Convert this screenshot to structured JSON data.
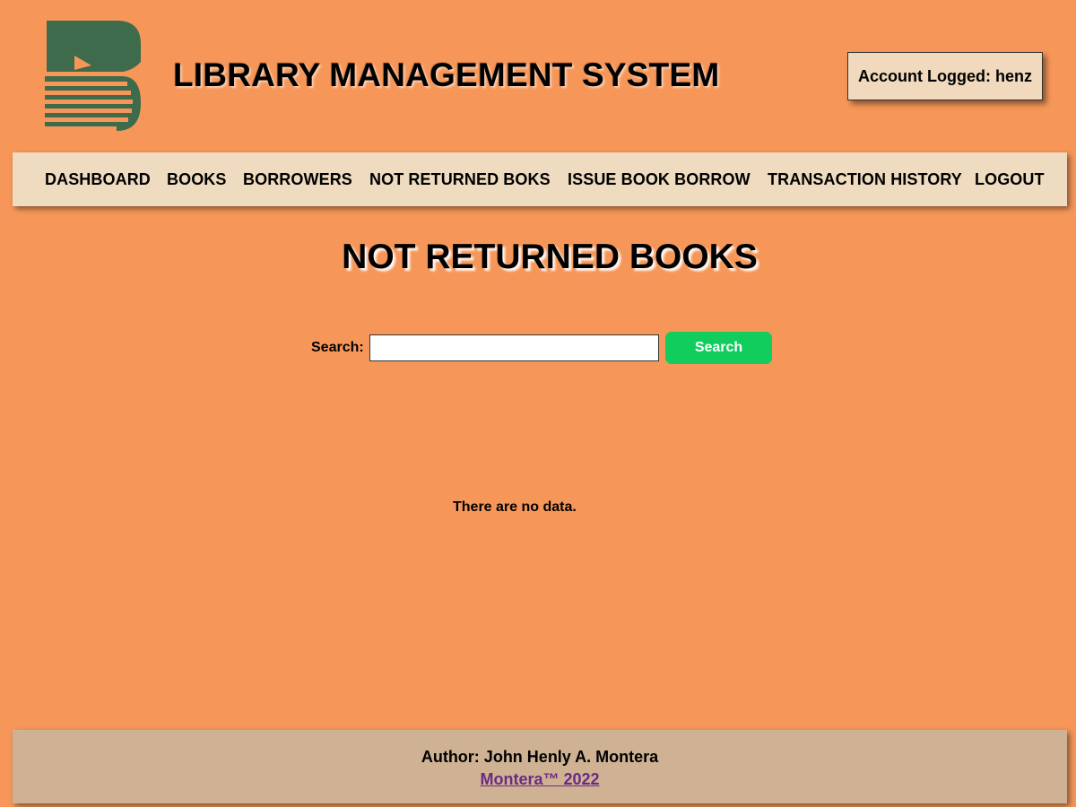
{
  "header": {
    "title": "LIBRARY MANAGEMENT SYSTEM",
    "account_text": "Account Logged: henz",
    "logo_icon": "book-logo-icon"
  },
  "nav": {
    "items": [
      {
        "label": "DASHBOARD"
      },
      {
        "label": "BOOKS"
      },
      {
        "label": "BORROWERS"
      },
      {
        "label": "NOT RETURNED BOKS"
      },
      {
        "label": "ISSUE BOOK BORROW"
      },
      {
        "label": "TRANSACTION HISTORY"
      },
      {
        "label": "LOGOUT"
      }
    ]
  },
  "main": {
    "heading": "NOT RETURNED BOOKS",
    "search_label": "Search:",
    "search_value": "",
    "search_button": "Search",
    "empty_message": "There are no data."
  },
  "footer": {
    "author": "Author: John Henly A. Montera",
    "link_text": "Montera™ 2022"
  },
  "colors": {
    "background": "#f69759",
    "logo_green": "#3d6b4c",
    "search_button": "#10cd5e",
    "footer_link": "#6c2a82"
  }
}
